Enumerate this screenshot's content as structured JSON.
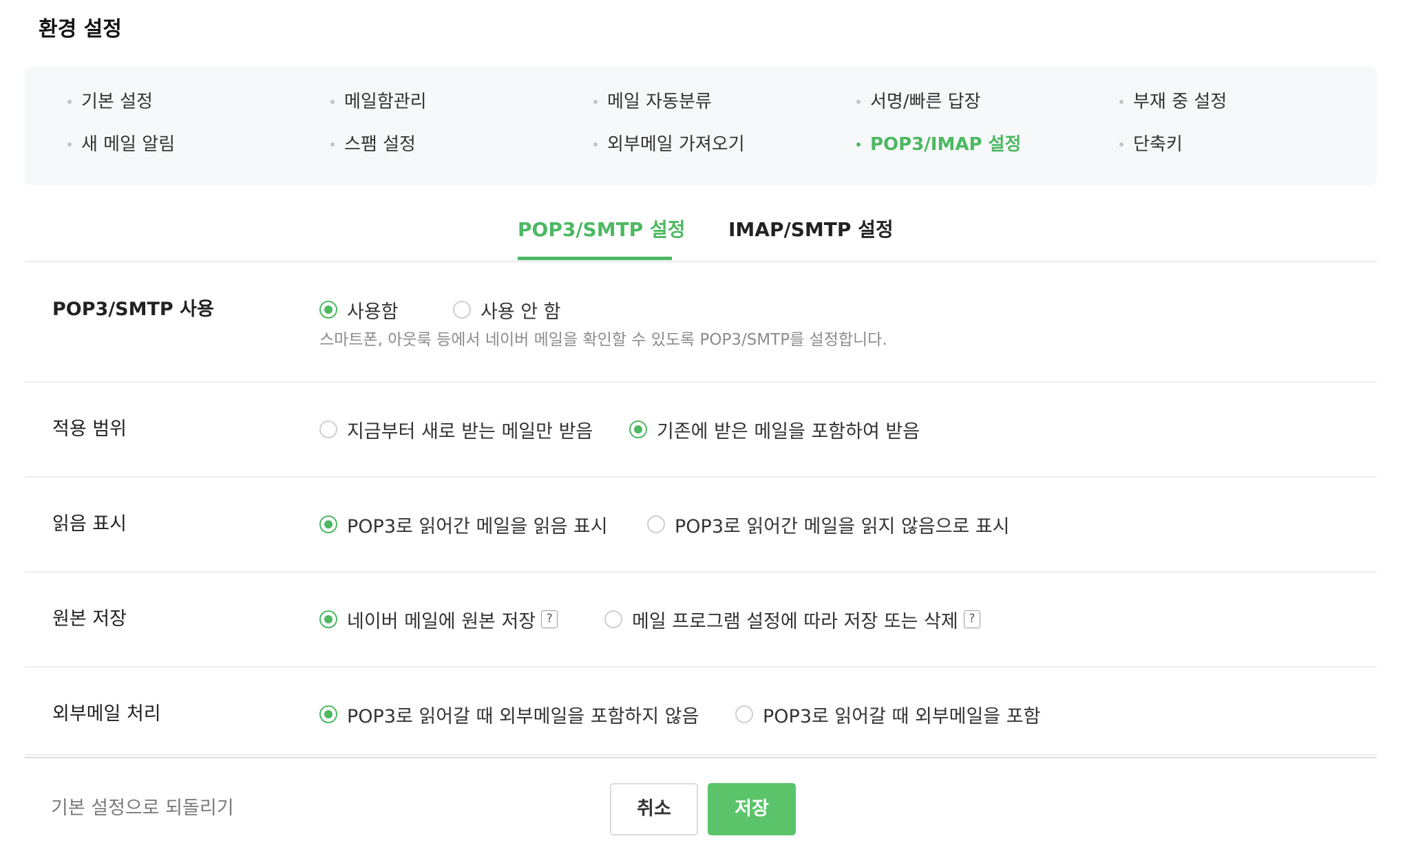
{
  "page": {
    "title": "환경 설정"
  },
  "menu": {
    "items": [
      {
        "label": "기본 설정",
        "active": false
      },
      {
        "label": "메일함관리",
        "active": false
      },
      {
        "label": "메일 자동분류",
        "active": false
      },
      {
        "label": "서명/빠른 답장",
        "active": false
      },
      {
        "label": "부재 중 설정",
        "active": false
      },
      {
        "label": "새 메일 알림",
        "active": false
      },
      {
        "label": "스팸 설정",
        "active": false
      },
      {
        "label": "외부메일 가져오기",
        "active": false
      },
      {
        "label": "POP3/IMAP 설정",
        "active": true
      },
      {
        "label": "단축키",
        "active": false
      }
    ]
  },
  "tabs": [
    {
      "label": "POP3/SMTP 설정",
      "active": true
    },
    {
      "label": "IMAP/SMTP 설정",
      "active": false
    }
  ],
  "settings": {
    "usage": {
      "label": "POP3/SMTP 사용",
      "options": [
        {
          "label": "사용함",
          "checked": true
        },
        {
          "label": "사용 안 함",
          "checked": false
        }
      ],
      "description": "스마트폰, 아웃룩 등에서 네이버 메일을 확인할 수 있도록 POP3/SMTP를 설정합니다."
    },
    "scope": {
      "label": "적용 범위",
      "options": [
        {
          "label": "지금부터 새로 받는 메일만 받음",
          "checked": false
        },
        {
          "label": "기존에 받은 메일을 포함하여 받음",
          "checked": true
        }
      ]
    },
    "read_mark": {
      "label": "읽음 표시",
      "options": [
        {
          "label": "POP3로 읽어간 메일을 읽음 표시",
          "checked": true
        },
        {
          "label": "POP3로 읽어간 메일을 읽지 않음으로 표시",
          "checked": false
        }
      ]
    },
    "original": {
      "label": "원본 저장",
      "options": [
        {
          "label": "네이버 메일에 원본 저장",
          "checked": true
        },
        {
          "label": "메일 프로그램 설정에 따라 저장 또는 삭제",
          "checked": false
        }
      ],
      "help_icon": "?"
    },
    "external": {
      "label": "외부메일 처리",
      "options": [
        {
          "label": "POP3로 읽어갈 때 외부메일을 포함하지 않음",
          "checked": true
        },
        {
          "label": "POP3로 읽어갈 때 외부메일을 포함",
          "checked": false
        }
      ]
    }
  },
  "footer": {
    "reset_label": "기본 설정으로 되돌리기",
    "cancel_label": "취소",
    "save_label": "저장"
  },
  "colors": {
    "accent": "#4cb862",
    "save_button": "#5bc46a",
    "menu_background": "#f7f8f9"
  }
}
